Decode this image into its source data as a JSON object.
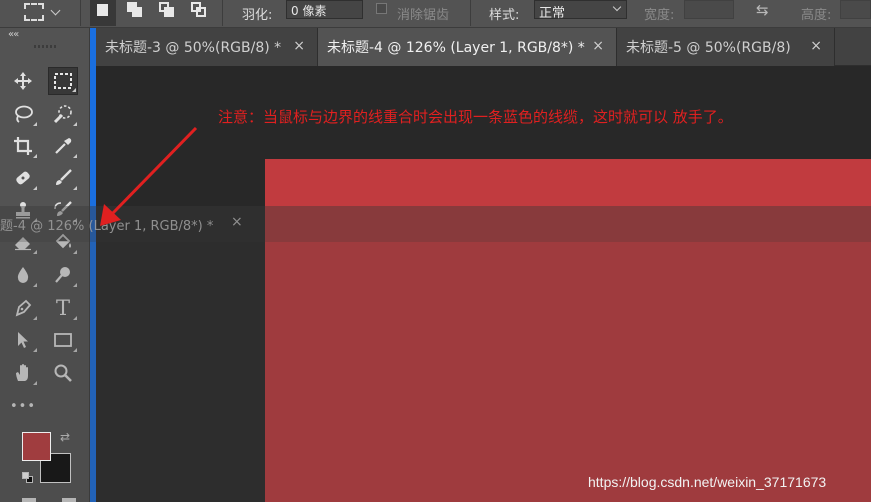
{
  "options_bar": {
    "feather_label": "羽化:",
    "feather_value": "0 像素",
    "antialias_label": "消除锯齿",
    "style_label": "样式:",
    "style_value": "正常",
    "width_label": "宽度:",
    "height_label": "高度:"
  },
  "tabs": [
    {
      "label": "未标题-3 @ 50%(RGB/8) *",
      "close": "×",
      "active": false
    },
    {
      "label": "未标题-4 @ 126% (Layer 1, RGB/8*) *",
      "close": "×",
      "active": true
    },
    {
      "label": "未标题-5 @ 50%(RGB/8)",
      "close": "×",
      "active": false
    }
  ],
  "floating_tab": {
    "label": "题-4 @ 126% (Layer 1, RGB/8*) *",
    "close": "×"
  },
  "annotation": {
    "text": "注意：当鼠标与边界的线重合时会出现一条蓝色的线缆，这时就可以 放手了。"
  },
  "toolbar": {
    "collapse": "««",
    "tools": [
      "move-tool",
      "rectangular-marquee-tool",
      "lasso-tool",
      "quick-selection-tool",
      "crop-tool",
      "eyedropper-tool",
      "spot-healing-brush-tool",
      "brush-tool",
      "clone-stamp-tool",
      "history-brush-tool",
      "eraser-tool",
      "paint-bucket-tool",
      "blur-tool",
      "dodge-tool",
      "pen-tool",
      "type-tool",
      "path-selection-tool",
      "rectangle-tool",
      "hand-tool",
      "zoom-tool",
      "edit-toolbar"
    ],
    "type_tool_glyph": "T",
    "more_glyph": "•••",
    "swap_glyph": "⇆"
  },
  "colors": {
    "foreground": "#a03d3f",
    "background": "#0c0c0c",
    "document_fill": "#c13b3f",
    "drop_indicator": "#1a6fe0",
    "annotation": "#e02020"
  },
  "watermark": "https://blog.csdn.net/weixin_37171673"
}
